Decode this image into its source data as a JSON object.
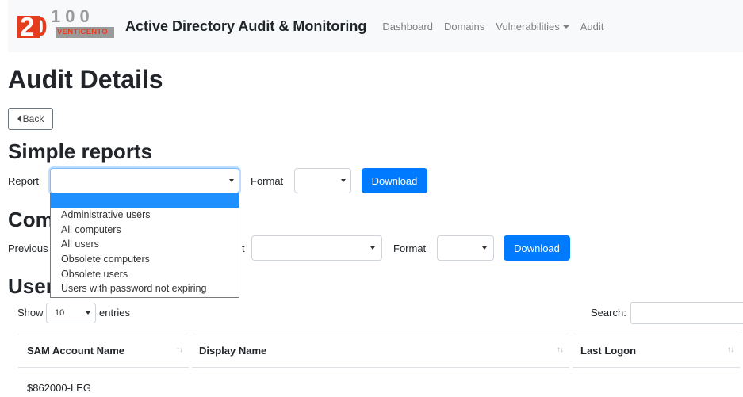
{
  "brand": {
    "logo_number": "20",
    "logo_sub": "100",
    "logo_text": "VENTICENTO",
    "title": "Active Directory Audit & Monitoring"
  },
  "nav": {
    "dashboard": "Dashboard",
    "domains": "Domains",
    "vulnerabilities": "Vulnerabilities",
    "audit": "Audit"
  },
  "page": {
    "title": "Audit Details",
    "back_label": "Back"
  },
  "simple_reports": {
    "heading": "Simple reports",
    "report_label": "Report",
    "report_value": "",
    "format_label": "Format",
    "format_value": "",
    "download_label": "Download",
    "options": [
      "",
      "Administrative users",
      "All computers",
      "All users",
      "Obsolete computers",
      "Obsolete users",
      "Users with password not expiring"
    ]
  },
  "comparison": {
    "heading_visible": "Com",
    "previous_label": "Previous",
    "format_label": "Format",
    "download_label": "Download"
  },
  "users": {
    "heading_visible": "User",
    "show_label": "Show",
    "entries_value": "10",
    "entries_label": "entries",
    "search_label": "Search:",
    "columns": [
      "SAM Account Name",
      "Display Name",
      "Last Logon"
    ],
    "rows": [
      {
        "sam": "$862000-LEG"
      }
    ]
  },
  "colors": {
    "primary": "#007bff",
    "logo_red": "#e63c1e",
    "logo_gray": "#9a9a9a",
    "navbar_bg": "#f8f9fa",
    "selected_option": "#1e90ff"
  },
  "icons": {
    "sort": "sort-icon",
    "back": "caret-left-icon",
    "dropdown": "caret-down-icon"
  }
}
